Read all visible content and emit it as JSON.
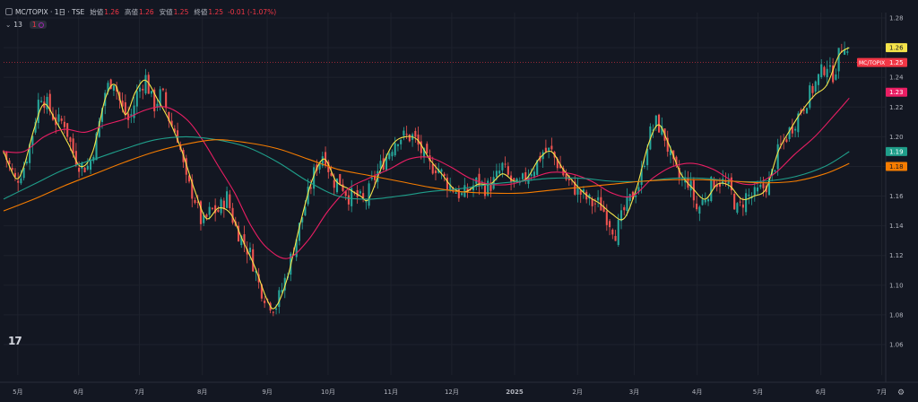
{
  "header": {
    "symbol": "MC/TOPIX · 1日 · TSE",
    "open_label": "始値",
    "open": "1.26",
    "high_label": "高値",
    "high": "1.26",
    "low_label": "安値",
    "low": "1.25",
    "close_label": "終値",
    "close": "1.25",
    "change": "-0.01 (-1.07%)"
  },
  "indicator": {
    "chevron": "⌄",
    "count": "13",
    "badge": "1"
  },
  "logo": "17",
  "colors": {
    "background": "#131722",
    "grid": "#1e222d",
    "up": "#26a69a",
    "down": "#ef5350",
    "ma_yellow": "#f5e44a",
    "ma_pink": "#e91e63",
    "ma_teal": "#1f9e8a",
    "ma_orange": "#f57c00",
    "axis_text": "#b2b5be"
  },
  "chart_data": {
    "type": "candlestick",
    "title": "MC/TOPIX · 1日 · TSE",
    "ylim": [
      1.05,
      1.29
    ],
    "y_ticks": [
      "1.28",
      "1.26",
      "1.24",
      "1.22",
      "1.20",
      "1.18",
      "1.16",
      "1.14",
      "1.12",
      "1.10",
      "1.08",
      "1.06"
    ],
    "x_ticks": [
      "5月",
      "6月",
      "7月",
      "8月",
      "9月",
      "10月",
      "11月",
      "12月",
      "2025",
      "2月",
      "3月",
      "4月",
      "5月",
      "6月",
      "7月"
    ],
    "x_tick_days": [
      7,
      37,
      67,
      98,
      130,
      160,
      191,
      221,
      252,
      283,
      311,
      342,
      372,
      403,
      433
    ],
    "days_total": 435,
    "last_price": 1.25,
    "price_labels": [
      {
        "text": "1.26",
        "value": 1.26,
        "color": "#f5e44a",
        "textColor": "#131722"
      },
      {
        "text": "MC/TOPIX  1.25",
        "value": 1.25,
        "color": "#f23645",
        "textColor": "#ffffff"
      },
      {
        "text": "1.23",
        "value": 1.23,
        "color": "#e91e63",
        "textColor": "#ffffff"
      },
      {
        "text": "1.19",
        "value": 1.19,
        "color": "#1f9e8a",
        "textColor": "#ffffff"
      },
      {
        "text": "1.18",
        "value": 1.18,
        "color": "#f57c00",
        "textColor": "#131722"
      }
    ],
    "close_path": [
      [
        0,
        1.19
      ],
      [
        6,
        1.17
      ],
      [
        10,
        1.18
      ],
      [
        14,
        1.2
      ],
      [
        18,
        1.23
      ],
      [
        22,
        1.22
      ],
      [
        26,
        1.21
      ],
      [
        30,
        1.21
      ],
      [
        34,
        1.19
      ],
      [
        38,
        1.18
      ],
      [
        42,
        1.18
      ],
      [
        46,
        1.2
      ],
      [
        50,
        1.23
      ],
      [
        54,
        1.24
      ],
      [
        58,
        1.22
      ],
      [
        62,
        1.21
      ],
      [
        66,
        1.23
      ],
      [
        70,
        1.24
      ],
      [
        74,
        1.22
      ],
      [
        78,
        1.23
      ],
      [
        82,
        1.21
      ],
      [
        86,
        1.2
      ],
      [
        90,
        1.17
      ],
      [
        94,
        1.16
      ],
      [
        98,
        1.14
      ],
      [
        102,
        1.15
      ],
      [
        106,
        1.15
      ],
      [
        110,
        1.16
      ],
      [
        114,
        1.14
      ],
      [
        118,
        1.13
      ],
      [
        122,
        1.12
      ],
      [
        126,
        1.1
      ],
      [
        130,
        1.09
      ],
      [
        134,
        1.085
      ],
      [
        138,
        1.1
      ],
      [
        142,
        1.12
      ],
      [
        146,
        1.14
      ],
      [
        150,
        1.16
      ],
      [
        154,
        1.18
      ],
      [
        158,
        1.19
      ],
      [
        162,
        1.17
      ],
      [
        166,
        1.17
      ],
      [
        170,
        1.16
      ],
      [
        174,
        1.16
      ],
      [
        178,
        1.155
      ],
      [
        182,
        1.17
      ],
      [
        186,
        1.18
      ],
      [
        190,
        1.19
      ],
      [
        194,
        1.2
      ],
      [
        198,
        1.2
      ],
      [
        202,
        1.2
      ],
      [
        206,
        1.19
      ],
      [
        210,
        1.18
      ],
      [
        214,
        1.18
      ],
      [
        218,
        1.17
      ],
      [
        222,
        1.165
      ],
      [
        226,
        1.16
      ],
      [
        230,
        1.165
      ],
      [
        234,
        1.17
      ],
      [
        238,
        1.165
      ],
      [
        242,
        1.17
      ],
      [
        246,
        1.18
      ],
      [
        250,
        1.17
      ],
      [
        254,
        1.165
      ],
      [
        258,
        1.175
      ],
      [
        262,
        1.18
      ],
      [
        266,
        1.19
      ],
      [
        270,
        1.19
      ],
      [
        274,
        1.18
      ],
      [
        278,
        1.17
      ],
      [
        282,
        1.165
      ],
      [
        286,
        1.16
      ],
      [
        290,
        1.155
      ],
      [
        294,
        1.155
      ],
      [
        298,
        1.145
      ],
      [
        302,
        1.135
      ],
      [
        306,
        1.15
      ],
      [
        310,
        1.16
      ],
      [
        314,
        1.17
      ],
      [
        318,
        1.2
      ],
      [
        322,
        1.21
      ],
      [
        326,
        1.2
      ],
      [
        330,
        1.18
      ],
      [
        334,
        1.17
      ],
      [
        338,
        1.17
      ],
      [
        342,
        1.15
      ],
      [
        346,
        1.16
      ],
      [
        350,
        1.17
      ],
      [
        354,
        1.17
      ],
      [
        358,
        1.165
      ],
      [
        362,
        1.15
      ],
      [
        366,
        1.16
      ],
      [
        370,
        1.16
      ],
      [
        374,
        1.165
      ],
      [
        378,
        1.17
      ],
      [
        382,
        1.19
      ],
      [
        386,
        1.2
      ],
      [
        390,
        1.21
      ],
      [
        394,
        1.22
      ],
      [
        398,
        1.23
      ],
      [
        402,
        1.24
      ],
      [
        406,
        1.25
      ],
      [
        408,
        1.24
      ],
      [
        410,
        1.245
      ],
      [
        413,
        1.26
      ],
      [
        415,
        1.265
      ],
      [
        417,
        1.25
      ]
    ],
    "series": [
      {
        "name": "",
        "color": "#f5e44a",
        "points": [
          [
            0,
            1.19
          ],
          [
            6,
            1.172
          ],
          [
            10,
            1.18
          ],
          [
            15,
            1.205
          ],
          [
            20,
            1.222
          ],
          [
            26,
            1.21
          ],
          [
            32,
            1.195
          ],
          [
            38,
            1.18
          ],
          [
            44,
            1.19
          ],
          [
            50,
            1.225
          ],
          [
            55,
            1.235
          ],
          [
            60,
            1.215
          ],
          [
            65,
            1.23
          ],
          [
            70,
            1.238
          ],
          [
            76,
            1.225
          ],
          [
            82,
            1.21
          ],
          [
            88,
            1.19
          ],
          [
            94,
            1.165
          ],
          [
            100,
            1.145
          ],
          [
            106,
            1.152
          ],
          [
            112,
            1.148
          ],
          [
            118,
            1.13
          ],
          [
            124,
            1.112
          ],
          [
            130,
            1.09
          ],
          [
            134,
            1.085
          ],
          [
            140,
            1.105
          ],
          [
            146,
            1.14
          ],
          [
            152,
            1.17
          ],
          [
            158,
            1.185
          ],
          [
            164,
            1.17
          ],
          [
            170,
            1.165
          ],
          [
            176,
            1.16
          ],
          [
            180,
            1.158
          ],
          [
            186,
            1.178
          ],
          [
            192,
            1.195
          ],
          [
            198,
            1.2
          ],
          [
            204,
            1.198
          ],
          [
            210,
            1.185
          ],
          [
            216,
            1.175
          ],
          [
            222,
            1.165
          ],
          [
            228,
            1.163
          ],
          [
            234,
            1.168
          ],
          [
            240,
            1.168
          ],
          [
            246,
            1.175
          ],
          [
            252,
            1.17
          ],
          [
            258,
            1.172
          ],
          [
            264,
            1.185
          ],
          [
            270,
            1.19
          ],
          [
            276,
            1.178
          ],
          [
            282,
            1.168
          ],
          [
            288,
            1.16
          ],
          [
            294,
            1.155
          ],
          [
            300,
            1.148
          ],
          [
            306,
            1.145
          ],
          [
            312,
            1.165
          ],
          [
            318,
            1.195
          ],
          [
            323,
            1.208
          ],
          [
            328,
            1.195
          ],
          [
            334,
            1.175
          ],
          [
            340,
            1.165
          ],
          [
            346,
            1.158
          ],
          [
            352,
            1.168
          ],
          [
            358,
            1.167
          ],
          [
            364,
            1.158
          ],
          [
            370,
            1.16
          ],
          [
            376,
            1.165
          ],
          [
            382,
            1.19
          ],
          [
            388,
            1.205
          ],
          [
            394,
            1.218
          ],
          [
            400,
            1.228
          ],
          [
            406,
            1.235
          ],
          [
            412,
            1.255
          ],
          [
            417,
            1.26
          ]
        ]
      },
      {
        "name": "",
        "color": "#e91e63",
        "points": [
          [
            0,
            1.19
          ],
          [
            10,
            1.19
          ],
          [
            20,
            1.2
          ],
          [
            30,
            1.205
          ],
          [
            40,
            1.203
          ],
          [
            50,
            1.208
          ],
          [
            60,
            1.212
          ],
          [
            70,
            1.218
          ],
          [
            80,
            1.22
          ],
          [
            90,
            1.212
          ],
          [
            98,
            1.198
          ],
          [
            106,
            1.18
          ],
          [
            114,
            1.162
          ],
          [
            122,
            1.14
          ],
          [
            130,
            1.125
          ],
          [
            140,
            1.118
          ],
          [
            150,
            1.13
          ],
          [
            160,
            1.15
          ],
          [
            170,
            1.165
          ],
          [
            180,
            1.172
          ],
          [
            190,
            1.178
          ],
          [
            200,
            1.185
          ],
          [
            210,
            1.186
          ],
          [
            220,
            1.18
          ],
          [
            230,
            1.172
          ],
          [
            240,
            1.168
          ],
          [
            250,
            1.168
          ],
          [
            260,
            1.172
          ],
          [
            270,
            1.176
          ],
          [
            280,
            1.175
          ],
          [
            290,
            1.17
          ],
          [
            300,
            1.162
          ],
          [
            310,
            1.16
          ],
          [
            320,
            1.172
          ],
          [
            330,
            1.18
          ],
          [
            340,
            1.182
          ],
          [
            350,
            1.178
          ],
          [
            360,
            1.17
          ],
          [
            370,
            1.168
          ],
          [
            380,
            1.175
          ],
          [
            390,
            1.188
          ],
          [
            400,
            1.2
          ],
          [
            410,
            1.215
          ],
          [
            417,
            1.226
          ]
        ]
      },
      {
        "name": "",
        "color": "#1f9e8a",
        "points": [
          [
            0,
            1.158
          ],
          [
            15,
            1.168
          ],
          [
            30,
            1.178
          ],
          [
            45,
            1.185
          ],
          [
            60,
            1.192
          ],
          [
            75,
            1.198
          ],
          [
            90,
            1.2
          ],
          [
            105,
            1.198
          ],
          [
            120,
            1.193
          ],
          [
            135,
            1.183
          ],
          [
            150,
            1.17
          ],
          [
            165,
            1.16
          ],
          [
            180,
            1.158
          ],
          [
            195,
            1.16
          ],
          [
            210,
            1.163
          ],
          [
            225,
            1.165
          ],
          [
            240,
            1.168
          ],
          [
            255,
            1.17
          ],
          [
            270,
            1.172
          ],
          [
            285,
            1.172
          ],
          [
            300,
            1.17
          ],
          [
            315,
            1.17
          ],
          [
            330,
            1.172
          ],
          [
            345,
            1.172
          ],
          [
            360,
            1.17
          ],
          [
            375,
            1.17
          ],
          [
            390,
            1.173
          ],
          [
            405,
            1.18
          ],
          [
            417,
            1.19
          ]
        ]
      },
      {
        "name": "",
        "color": "#f57c00",
        "points": [
          [
            0,
            1.15
          ],
          [
            15,
            1.158
          ],
          [
            30,
            1.167
          ],
          [
            45,
            1.175
          ],
          [
            60,
            1.183
          ],
          [
            75,
            1.19
          ],
          [
            90,
            1.195
          ],
          [
            105,
            1.198
          ],
          [
            120,
            1.196
          ],
          [
            135,
            1.192
          ],
          [
            150,
            1.185
          ],
          [
            165,
            1.178
          ],
          [
            180,
            1.174
          ],
          [
            195,
            1.17
          ],
          [
            210,
            1.166
          ],
          [
            225,
            1.163
          ],
          [
            240,
            1.162
          ],
          [
            255,
            1.162
          ],
          [
            270,
            1.164
          ],
          [
            285,
            1.166
          ],
          [
            300,
            1.168
          ],
          [
            315,
            1.17
          ],
          [
            330,
            1.171
          ],
          [
            345,
            1.171
          ],
          [
            360,
            1.17
          ],
          [
            375,
            1.169
          ],
          [
            390,
            1.17
          ],
          [
            405,
            1.175
          ],
          [
            417,
            1.182
          ]
        ]
      }
    ]
  }
}
